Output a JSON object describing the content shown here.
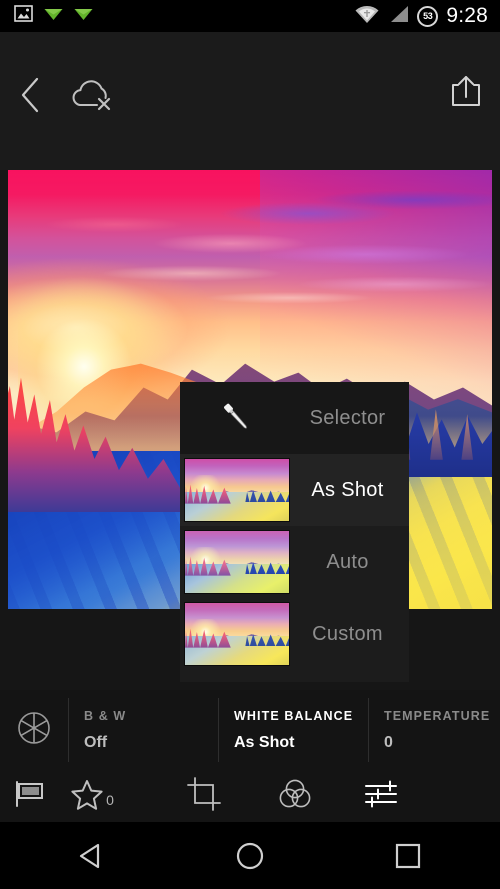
{
  "statusbar": {
    "time": "9:28",
    "battery_percent": "53",
    "icons": [
      "image-icon",
      "paper-plane-icon",
      "paper-plane-icon",
      "wifi-icon",
      "signal-icon",
      "battery-icon"
    ]
  },
  "topbar": {
    "back_label": "Back",
    "cloud_label": "Sync paused",
    "share_label": "Share"
  },
  "photo": {
    "alt": "Vivid sunset over snowy mountains with pine trees"
  },
  "white_balance_menu": {
    "items": [
      {
        "label": "Selector",
        "type": "eyedropper",
        "selected": false
      },
      {
        "label": "As Shot",
        "type": "thumbnail",
        "selected": true
      },
      {
        "label": "Auto",
        "type": "thumbnail",
        "selected": false
      },
      {
        "label": "Custom",
        "type": "thumbnail",
        "selected": false
      }
    ]
  },
  "info_panel": {
    "aperture_icon": "aperture-icon",
    "cells": [
      {
        "title": "B & W",
        "value": "Off",
        "active": false
      },
      {
        "title": "WHITE BALANCE",
        "value": "As Shot",
        "active": true
      },
      {
        "title": "TEMPERATURE",
        "value": "0",
        "active": false
      }
    ]
  },
  "bottom_toolbar": {
    "flag_label": "Flag",
    "star_label": "Rating",
    "star_count": "0",
    "crop_label": "Crop",
    "color_label": "Color",
    "sliders_label": "Adjustments"
  },
  "navbar": {
    "back": "Back",
    "home": "Home",
    "recents": "Recents"
  },
  "colors": {
    "panel_bg": "#1c1c1c",
    "panel_active": "#232323",
    "accent_white": "#ffffff",
    "muted": "#8e8e8e",
    "bar_bg": "#141414"
  }
}
